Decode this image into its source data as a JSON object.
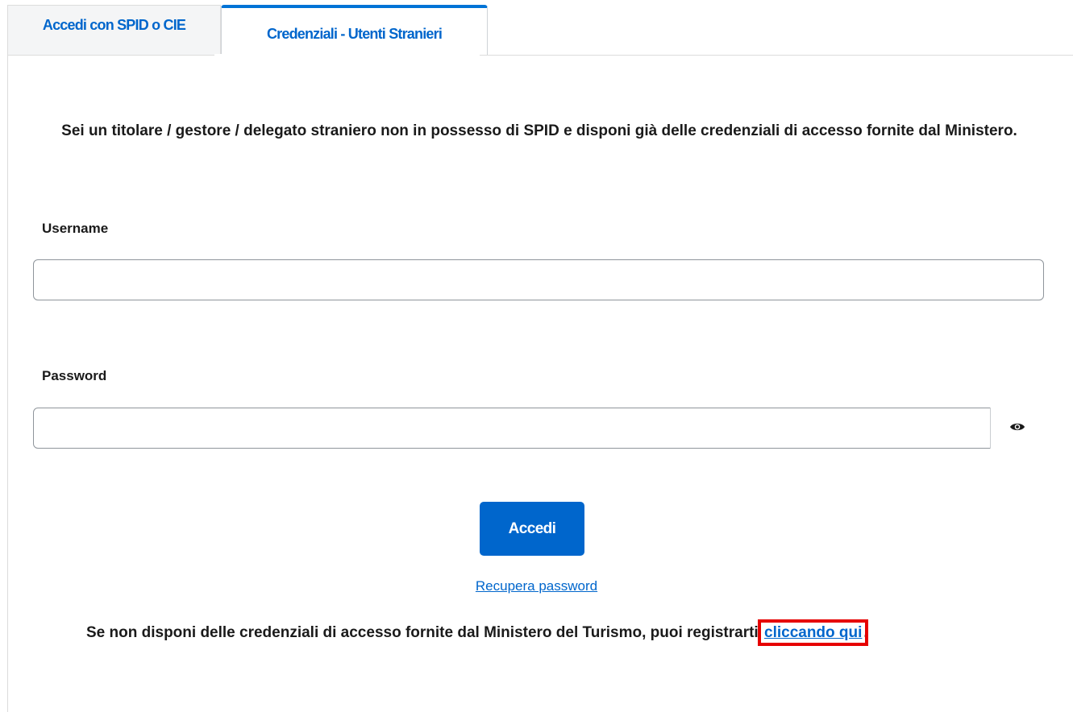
{
  "tabs": [
    {
      "label": "Accedi con SPID o CIE",
      "active": false
    },
    {
      "label": "Credenziali - Utenti Stranieri",
      "active": true
    }
  ],
  "intro_text": "Sei un titolare / gestore / delegato straniero non in possesso di SPID e disponi già delle credenziali di accesso fornite dal Ministero.",
  "form": {
    "username_label": "Username",
    "username_value": "",
    "password_label": "Password",
    "password_value": "",
    "show_password_icon": "eye-icon",
    "submit_label": "Accedi"
  },
  "recover_password_label": "Recupera password",
  "register": {
    "prefix": "Se non disponi delle credenziali di accesso fornite dal Ministero del Turismo, puoi registrarti ",
    "link_label": "cliccando qui",
    "suffix": "."
  },
  "colors": {
    "accent": "#0066cc",
    "tab_indicator": "#0073d6",
    "highlight": "#e60000"
  }
}
